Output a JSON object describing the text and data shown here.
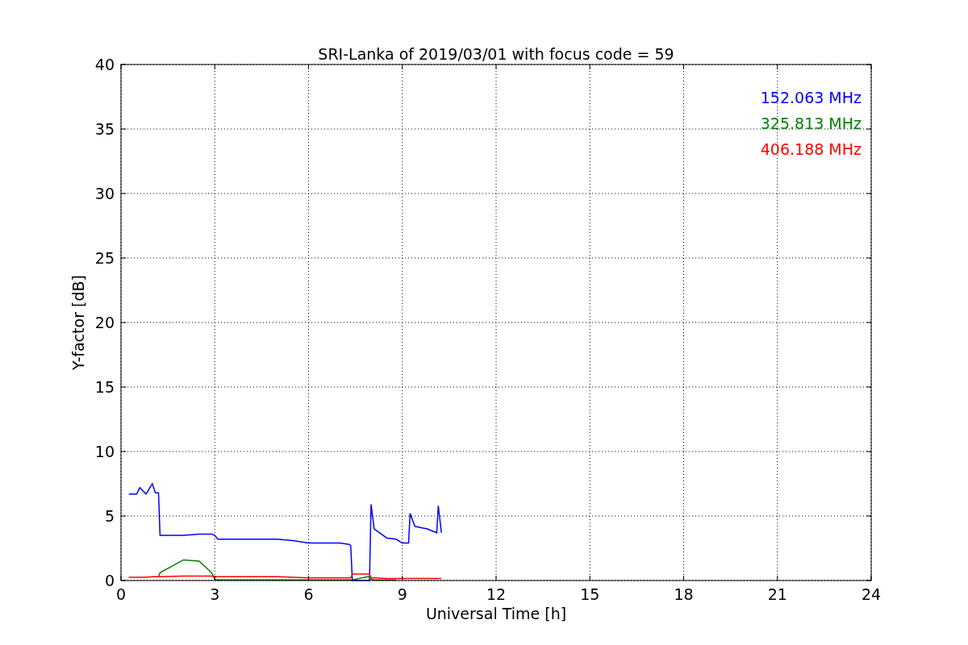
{
  "figure": {
    "chart_data": {
      "type": "line",
      "title": "SRI-Lanka of 2019/03/01 with focus code = 59",
      "xlabel": "Universal Time [h]",
      "ylabel": "Y-factor [dB]",
      "x": [
        0.25,
        0.5,
        0.6,
        0.8,
        1.0,
        1.1,
        1.2,
        1.25,
        2.0,
        2.5,
        2.9,
        3.0,
        3.1,
        4.0,
        5.0,
        5.5,
        6.0,
        7.0,
        7.3,
        7.35,
        7.4,
        7.9,
        7.95,
        8.0,
        8.1,
        8.5,
        8.8,
        9.0,
        9.2,
        9.25,
        9.4,
        9.6,
        9.8,
        10.0,
        10.1,
        10.15,
        10.25
      ],
      "series": [
        {
          "name": "152.063 MHz",
          "color": "#0000ff",
          "values": [
            6.7,
            6.7,
            7.2,
            6.7,
            7.5,
            6.8,
            6.8,
            3.5,
            3.5,
            3.6,
            3.6,
            3.5,
            3.2,
            3.2,
            3.2,
            3.1,
            2.9,
            2.9,
            2.8,
            2.7,
            0.0,
            0.0,
            0.0,
            5.9,
            4.0,
            3.3,
            3.2,
            2.9,
            2.9,
            5.2,
            4.2,
            4.1,
            4.0,
            3.8,
            3.7,
            5.8,
            3.7
          ]
        },
        {
          "name": "325.813 MHz",
          "color": "#008000",
          "values": [
            null,
            null,
            null,
            null,
            null,
            null,
            0.3,
            0.6,
            1.6,
            1.5,
            0.6,
            0.1,
            0.05,
            0.05,
            0.05,
            0.05,
            0.05,
            0.05,
            0.05,
            0.05,
            0.05,
            0.3,
            0.3,
            0.1,
            0.05,
            0.05,
            0.05,
            null,
            null,
            null,
            null,
            null,
            null,
            null,
            null,
            null,
            null
          ]
        },
        {
          "name": "406.188 MHz",
          "color": "#ff0000",
          "values": [
            0.25,
            0.25,
            0.25,
            0.25,
            0.3,
            0.3,
            0.3,
            0.3,
            0.35,
            0.35,
            0.35,
            0.3,
            0.3,
            0.3,
            0.3,
            0.25,
            0.2,
            0.2,
            0.2,
            0.2,
            0.5,
            0.5,
            0.5,
            0.2,
            0.2,
            0.15,
            0.15,
            0.15,
            0.15,
            0.15,
            0.15,
            0.15,
            0.15,
            0.15,
            0.15,
            0.15,
            0.15
          ]
        }
      ],
      "grid": true,
      "xlim": [
        0,
        24
      ],
      "ylim": [
        0,
        40
      ],
      "xticks": [
        0,
        3,
        6,
        9,
        12,
        15,
        18,
        21,
        24
      ],
      "yticks": [
        0,
        5,
        10,
        15,
        20,
        25,
        30,
        35,
        40
      ]
    }
  }
}
